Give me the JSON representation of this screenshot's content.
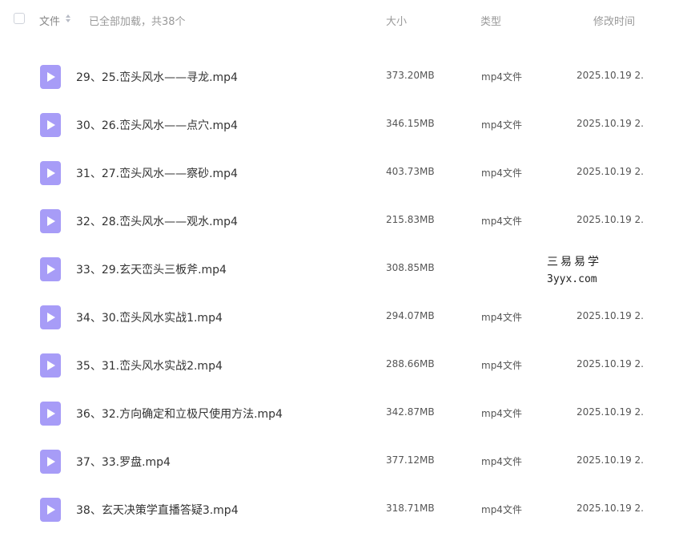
{
  "header": {
    "file_label": "文件",
    "loaded_text": "已全部加载，共38个",
    "size_label": "大小",
    "type_label": "类型",
    "modified_label": "修改时间"
  },
  "files": [
    {
      "name": "29、25.峦头风水——寻龙.mp4",
      "size": "373.20MB",
      "type": "mp4文件",
      "time": "2025.10.19 2..."
    },
    {
      "name": "30、26.峦头风水——点穴.mp4",
      "size": "346.15MB",
      "type": "mp4文件",
      "time": "2025.10.19 2..."
    },
    {
      "name": "31、27.峦头风水——察砂.mp4",
      "size": "403.73MB",
      "type": "mp4文件",
      "time": "2025.10.19 2..."
    },
    {
      "name": "32、28.峦头风水——观水.mp4",
      "size": "215.83MB",
      "type": "mp4文件",
      "time": "2025.10.19 2..."
    },
    {
      "name": "33、29.玄天峦头三板斧.mp4",
      "size": "308.85MB",
      "type": "",
      "time": ""
    },
    {
      "name": "34、30.峦头风水实战1.mp4",
      "size": "294.07MB",
      "type": "mp4文件",
      "time": "2025.10.19 2..."
    },
    {
      "name": "35、31.峦头风水实战2.mp4",
      "size": "288.66MB",
      "type": "mp4文件",
      "time": "2025.10.19 2..."
    },
    {
      "name": "36、32.方向确定和立极尺使用方法.mp4",
      "size": "342.87MB",
      "type": "mp4文件",
      "time": "2025.10.19 2..."
    },
    {
      "name": "37、33.罗盘.mp4",
      "size": "377.12MB",
      "type": "mp4文件",
      "time": "2025.10.19 2..."
    },
    {
      "name": "38、玄天决策学直播答疑3.mp4",
      "size": "318.71MB",
      "type": "mp4文件",
      "time": "2025.10.19 2..."
    }
  ],
  "icons": {
    "file_icon": "video-file-icon",
    "file_icon_color": "#a79cf7"
  },
  "watermark": {
    "title": "三易易学",
    "url": "3yyx.com"
  }
}
